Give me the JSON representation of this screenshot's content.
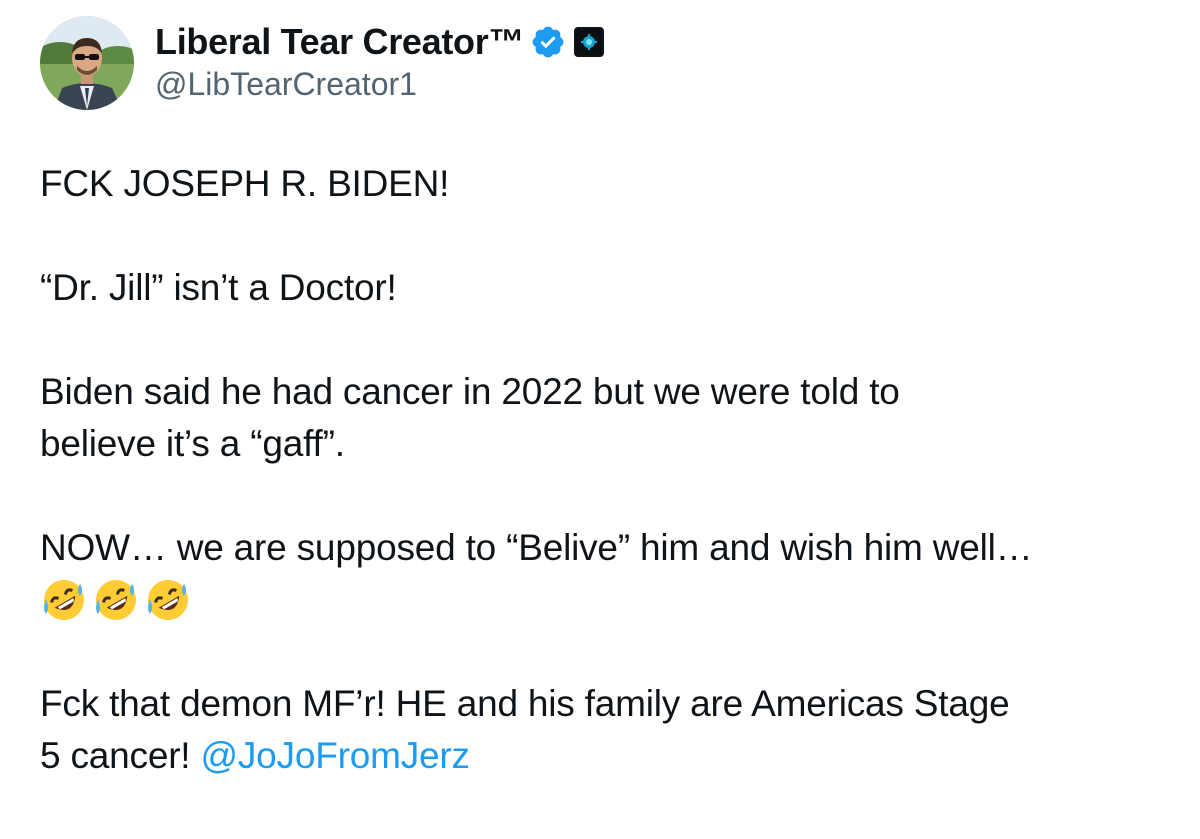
{
  "user": {
    "display_name": "Liberal Tear Creator™",
    "handle": "@LibTearCreator1",
    "verified_icon": "verified-badge-icon",
    "affiliate_icon": "affiliate-badge-icon"
  },
  "tweet": {
    "lines": {
      "p1": "FCK JOSEPH R. BIDEN!",
      "p2": "“Dr. Jill” isn’t a Doctor!",
      "p3a": "Biden said he had cancer in 2022 but we were told to",
      "p3b": "believe it’s a “gaff”.",
      "p4": "NOW… we are supposed to “Belive” him and wish him well…",
      "p5a": "Fck that demon MF’r! HE and his family are Americas Stage",
      "p5b": "5 cancer! ",
      "mention": "@JoJoFromJerz"
    },
    "emojis": [
      "rolling-on-floor-laughing-emoji",
      "rolling-on-floor-laughing-emoji",
      "rolling-on-floor-laughing-emoji"
    ]
  },
  "colors": {
    "text": "#0f1419",
    "secondary": "#536471",
    "link": "#1d9bf0",
    "verified": "#1d9bf0"
  }
}
